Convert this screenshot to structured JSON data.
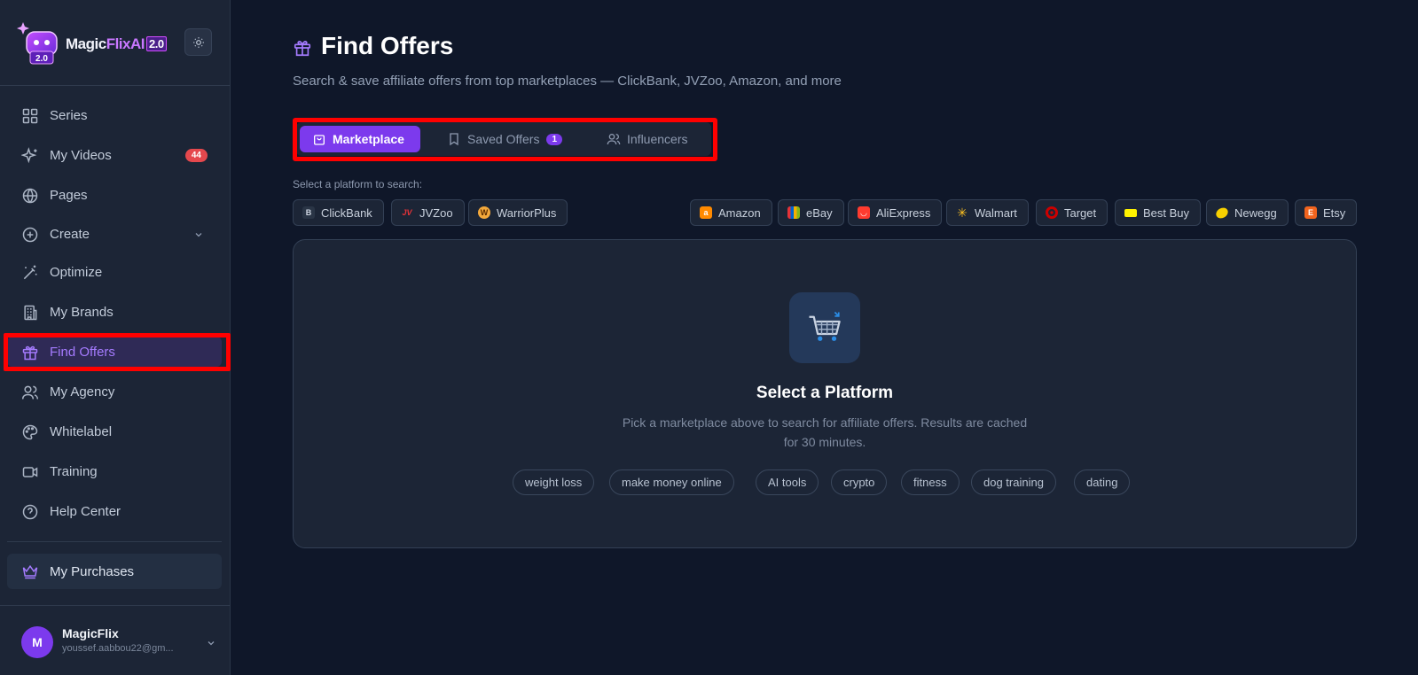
{
  "brand": {
    "name_part1": "Magic",
    "name_part2": "FlixAI",
    "version": "2.0"
  },
  "sidebar": {
    "items": [
      {
        "label": "Series",
        "icon": "grid-icon"
      },
      {
        "label": "My Videos",
        "icon": "sparkles-icon",
        "badge": "44"
      },
      {
        "label": "Pages",
        "icon": "globe-icon"
      },
      {
        "label": "Create",
        "icon": "plus-circle-icon"
      },
      {
        "label": "Optimize",
        "icon": "magic-wand-icon"
      },
      {
        "label": "My Brands",
        "icon": "building-icon"
      },
      {
        "label": "Find Offers",
        "icon": "gift-icon",
        "active": true
      },
      {
        "label": "My Agency",
        "icon": "users-icon"
      },
      {
        "label": "Whitelabel",
        "icon": "palette-icon"
      },
      {
        "label": "Training",
        "icon": "video-camera-icon"
      },
      {
        "label": "Help Center",
        "icon": "help-circle-icon"
      }
    ],
    "purchases": {
      "label": "My Purchases",
      "icon": "crown-icon"
    }
  },
  "user": {
    "initial": "M",
    "name": "MagicFlix",
    "email": "youssef.aabbou22@gm..."
  },
  "page": {
    "title": "Find Offers",
    "subtitle": "Search & save affiliate offers from top marketplaces — ClickBank, JVZoo, Amazon, and more"
  },
  "tabs": [
    {
      "label": "Marketplace",
      "active": true
    },
    {
      "label": "Saved Offers",
      "count": "1"
    },
    {
      "label": "Influencers"
    }
  ],
  "platforms": {
    "label": "Select a platform to search:",
    "affiliate": [
      {
        "label": "ClickBank",
        "icon": "B"
      },
      {
        "label": "JVZoo",
        "icon": "JV"
      },
      {
        "label": "WarriorPlus",
        "icon": "W"
      }
    ],
    "retail": [
      {
        "label": "Amazon",
        "color": "#ff8a00"
      },
      {
        "label": "eBay",
        "color": "#e53238"
      },
      {
        "label": "AliExpress",
        "color": "#ff3b2f"
      },
      {
        "label": "Walmart",
        "color": "#ffc220"
      },
      {
        "label": "Target",
        "color": "#cc0000"
      },
      {
        "label": "Best Buy",
        "color": "#fff200"
      },
      {
        "label": "Newegg",
        "color": "#f7a800"
      },
      {
        "label": "Etsy",
        "color": "#f1641e"
      }
    ]
  },
  "empty_state": {
    "title": "Select a Platform",
    "description": "Pick a marketplace above to search for affiliate offers. Results are cached for 30 minutes.",
    "suggestions": [
      "weight loss",
      "make money online",
      "AI tools",
      "crypto",
      "fitness",
      "dog training",
      "dating"
    ]
  },
  "colors": {
    "accent": "#7c3aed",
    "accent_text": "#a57bff",
    "badge": "#e5484d",
    "highlight": "#ff0000"
  }
}
